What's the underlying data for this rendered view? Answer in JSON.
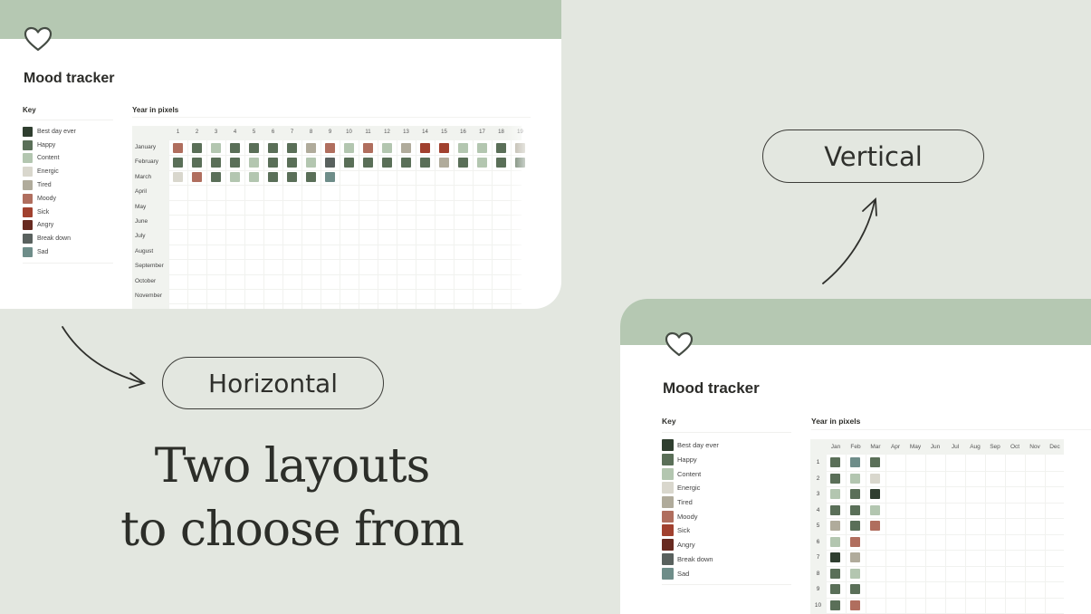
{
  "headline": {
    "line1": "Two layouts",
    "line2": "to choose from"
  },
  "labels": {
    "horizontal": "Horizontal",
    "vertical": "Vertical"
  },
  "moods": [
    {
      "name": "Best day ever",
      "color": "#2f3e2f"
    },
    {
      "name": "Happy",
      "color": "#5a6f58"
    },
    {
      "name": "Content",
      "color": "#b3c6b0"
    },
    {
      "name": "Energic",
      "color": "#d9d7cd"
    },
    {
      "name": "Tired",
      "color": "#b0ab9b"
    },
    {
      "name": "Moody",
      "color": "#b06e5e"
    },
    {
      "name": "Sick",
      "color": "#a1412f"
    },
    {
      "name": "Angry",
      "color": "#672a20"
    },
    {
      "name": "Break down",
      "color": "#59615e"
    },
    {
      "name": "Sad",
      "color": "#6e8d89"
    }
  ],
  "colors": {
    "banner": "#b5c8b2",
    "background": "#e3e7e0",
    "ink": "#2e2e2a"
  },
  "horizontal_card": {
    "icon": "heart-icon",
    "title": "Mood tracker",
    "key_title": "Key",
    "grid_title": "Year in pixels",
    "columns": [
      "1",
      "2",
      "3",
      "4",
      "5",
      "6",
      "7",
      "8",
      "9",
      "10",
      "11",
      "12",
      "13",
      "14",
      "15",
      "16",
      "17",
      "18",
      "19"
    ],
    "rows": [
      {
        "label": "January",
        "days": [
          "Moody",
          "Happy",
          "Content",
          "Happy",
          "Happy",
          "Happy",
          "Happy",
          "Tired",
          "Moody",
          "Content",
          "Moody",
          "Content",
          "Tired",
          "Sick",
          "Sick",
          "Content",
          "Content",
          "Happy",
          "Tired"
        ]
      },
      {
        "label": "February",
        "days": [
          "Happy",
          "Happy",
          "Happy",
          "Happy",
          "Content",
          "Happy",
          "Happy",
          "Content",
          "Break down",
          "Happy",
          "Happy",
          "Happy",
          "Happy",
          "Happy",
          "Tired",
          "Happy",
          "Content",
          "Happy",
          "Happy"
        ]
      },
      {
        "label": "March",
        "days": [
          "Energic",
          "Moody",
          "Happy",
          "Content",
          "Content",
          "Happy",
          "Happy",
          "Happy",
          "Sad"
        ]
      },
      {
        "label": "April",
        "days": []
      },
      {
        "label": "May",
        "days": []
      },
      {
        "label": "June",
        "days": []
      },
      {
        "label": "July",
        "days": []
      },
      {
        "label": "August",
        "days": []
      },
      {
        "label": "September",
        "days": []
      },
      {
        "label": "October",
        "days": []
      },
      {
        "label": "November",
        "days": []
      }
    ]
  },
  "vertical_card": {
    "icon": "heart-icon",
    "title": "Mood tracker",
    "key_title": "Key",
    "grid_title": "Year in pixels",
    "columns": [
      "Jan",
      "Feb",
      "Mar",
      "Apr",
      "May",
      "Jun",
      "Jul",
      "Aug",
      "Sep",
      "Oct",
      "Nov",
      "Dec"
    ],
    "rows": [
      "1",
      "2",
      "3",
      "4",
      "5",
      "6",
      "7",
      "8",
      "9",
      "10"
    ],
    "months": [
      {
        "month": "Jan",
        "days": [
          "Happy",
          "Happy",
          "Content",
          "Happy",
          "Tired",
          "Content",
          "Best day ever",
          "Happy",
          "Happy",
          "Happy"
        ]
      },
      {
        "month": "Feb",
        "days": [
          "Sad",
          "Content",
          "Happy",
          "Happy",
          "Happy",
          "Moody",
          "Tired",
          "Content",
          "Happy",
          "Moody"
        ]
      },
      {
        "month": "Mar",
        "days": [
          "Happy",
          "Energic",
          "Best day ever",
          "Content",
          "Moody"
        ]
      }
    ]
  }
}
